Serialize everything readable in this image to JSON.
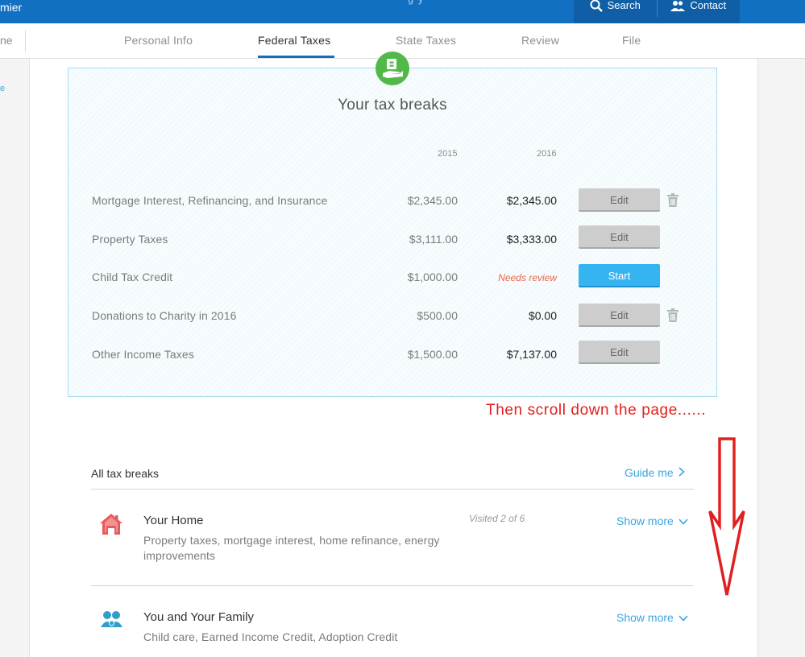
{
  "header": {
    "brand": "mier",
    "faint_text": "g        y",
    "search_label": "Search",
    "contact_label": "Contact",
    "colors": {
      "bar": "#1270c2",
      "actions": "#0f5ea6"
    }
  },
  "nav": {
    "left_text": "ne",
    "tabs": [
      {
        "label": "Personal Info",
        "active": false
      },
      {
        "label": "Federal Taxes",
        "active": true
      },
      {
        "label": "State Taxes",
        "active": false
      },
      {
        "label": "Review",
        "active": false
      },
      {
        "label": "File",
        "active": false
      }
    ],
    "side_link": "e"
  },
  "tax_breaks": {
    "title": "Your tax breaks",
    "icon": "money-hand-icon",
    "col_2015": "2015",
    "col_2016": "2016",
    "rows": [
      {
        "label": "Mortgage Interest, Refinancing, and Insurance",
        "v2015": "$2,345.00",
        "v2016": "$2,345.00",
        "button": "Edit",
        "has_delete": true
      },
      {
        "label": "Property Taxes",
        "v2015": "$3,111.00",
        "v2016": "$3,333.00",
        "button": "Edit",
        "has_delete": false
      },
      {
        "label": "Child Tax Credit",
        "v2015": "$1,000.00",
        "v2016": "Needs review",
        "button": "Start",
        "has_delete": false
      },
      {
        "label": "Donations to Charity in 2016",
        "v2015": "$500.00",
        "v2016": "$0.00",
        "button": "Edit",
        "has_delete": true
      },
      {
        "label": "Other Income Taxes",
        "v2015": "$1,500.00",
        "v2016": "$7,137.00",
        "button": "Edit",
        "has_delete": false
      }
    ]
  },
  "annotation": {
    "text": "Then scroll down the page......",
    "color": "#e0201e"
  },
  "all_breaks": {
    "title": "All tax breaks",
    "guide_label": "Guide me",
    "categories": [
      {
        "title": "Your Home",
        "desc": "Property taxes, mortgage interest, home refinance, energy improvements",
        "visited": "Visited 2 of 6",
        "show_more": "Show more",
        "icon": "house-icon"
      },
      {
        "title": "You and Your Family",
        "desc": "Child care, Earned Income Credit, Adoption Credit",
        "visited": "",
        "show_more": "Show more",
        "icon": "family-icon"
      }
    ]
  },
  "colors": {
    "accent_blue": "#3ba4e0",
    "start_button": "#36b4f2",
    "needs_review": "#e8654a",
    "house_icon": "#e85b5b",
    "family_icon": "#2f9fc9",
    "panel_icon": "#52b848"
  }
}
